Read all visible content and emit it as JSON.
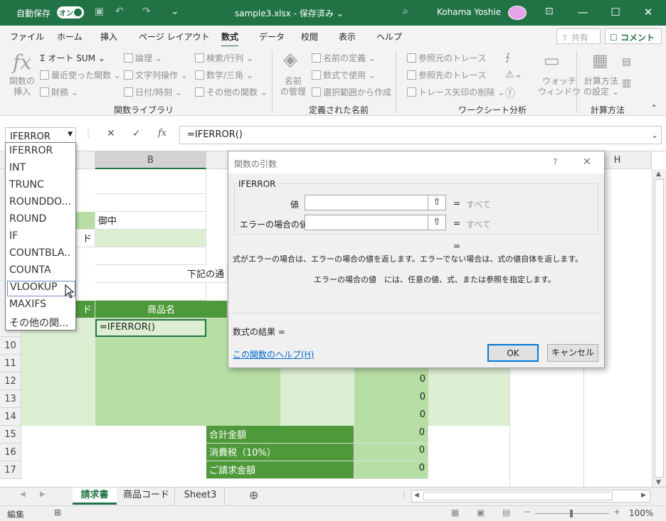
{
  "titlebar": {
    "autosave_label": "自動保存",
    "autosave_state": "オン",
    "doc_title": "sample3.xlsx - 保存済み ⌄",
    "user_name": "Kohama Yoshie",
    "min": "—",
    "max": "☐",
    "close": "✕"
  },
  "ribbon_tabs": [
    "ファイル",
    "ホーム",
    "挿入",
    "ページ レイアウト",
    "数式",
    "データ",
    "校閲",
    "表示",
    "ヘルプ"
  ],
  "share_label": "共有",
  "comment_label": "コメント",
  "ribbon": {
    "insert_fn": "関数の\n挿入",
    "autosum": "オート SUM ⌄",
    "recent": "最近使った関数 ⌄",
    "financial": "財務 ⌄",
    "logical": "論理 ⌄",
    "text": "文字列操作 ⌄",
    "datetime": "日付/時刻 ⌄",
    "lookup": "検索/行列 ⌄",
    "math": "数学/三角 ⌄",
    "more": "その他の関数 ⌄",
    "group1": "関数ライブラリ",
    "name_mgr": "名前\nの管理",
    "define_name": "名前の定義 ⌄",
    "use_in_formula": "数式で使用 ⌄",
    "create_from_sel": "選択範囲から作成",
    "group2": "定義された名前",
    "trace_prec": "参照元のトレース",
    "trace_dep": "参照先のトレース",
    "remove_arrows": "トレース矢印の削除 ⌄",
    "watch": "ウォッチ\nウィンドウ",
    "group3": "ワークシート分析",
    "calc_opts": "計算方法\nの設定 ⌄",
    "group4": "計算方法"
  },
  "formula_bar": {
    "name_box": "IFERROR",
    "formula": "=IFERROR()"
  },
  "columns": [
    "B",
    "H"
  ],
  "rows": [
    "10",
    "11",
    "12",
    "13",
    "14",
    "15",
    "16",
    "17"
  ],
  "cells": {
    "b4": "御中",
    "a5": "ド",
    "c7": "下記の通",
    "a9": "ド",
    "b9": "商品名",
    "b10": "=IFERROR()",
    "e12": "0",
    "e13": "0",
    "e14": "0",
    "c15": "合計金額",
    "e15": "0",
    "c16": "消費税（10%）",
    "e16": "0",
    "c17": "ご請求金額",
    "e17": "0"
  },
  "dropdown": [
    "IFERROR",
    "INT",
    "TRUNC",
    "ROUNDDO...",
    "ROUND",
    "IF",
    "COUNTBLA..",
    "COUNTA",
    "VLOOKUP",
    "MAXIFS",
    "その他の関..."
  ],
  "dialog": {
    "title": "関数の引数",
    "help_q": "?",
    "close": "✕",
    "fn_name": "IFERROR",
    "arg1_label": "値",
    "arg2_label": "エラーの場合の値",
    "arg1_hint": "すべて",
    "arg2_hint": "すべて",
    "eq": "=",
    "description": "式がエラーの場合は、エラーの場合の値を返します。エラーでない場合は、式の値自体を返します。",
    "arg_desc": "エラーの場合の値　には、任意の値、式、または参照を指定します。",
    "result_label": "数式の結果 =",
    "help_link": "この関数のヘルプ(H)",
    "ok": "OK",
    "cancel": "キャンセル"
  },
  "sheet_tabs": [
    "請求書",
    "商品コード",
    "Sheet3"
  ],
  "status": {
    "mode": "編集",
    "zoom": "100%"
  },
  "colors": {
    "brand": "#217346",
    "dark_green": "#4e9a3a",
    "mid_green": "#b7dfa4",
    "light_green": "#dcefd3"
  }
}
